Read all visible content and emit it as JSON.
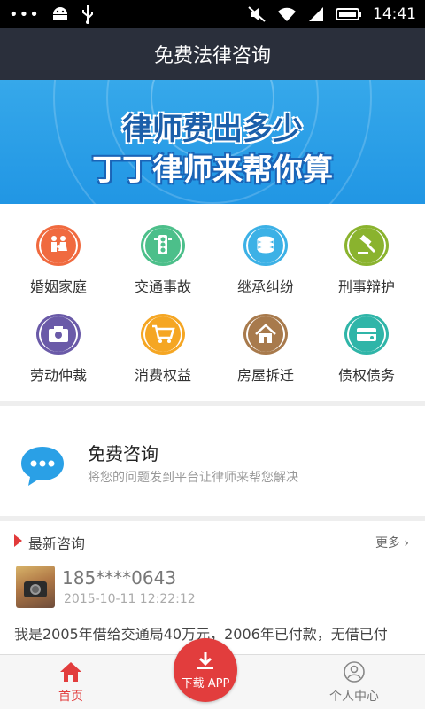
{
  "status_bar": {
    "dots": "•••",
    "time": "14:41",
    "icons": [
      "android-icon",
      "usb-icon",
      "mute-icon",
      "wifi-icon",
      "signal-icon",
      "battery-icon"
    ]
  },
  "header": {
    "title": "免费法律咨询"
  },
  "banner": {
    "line1": "律师费出多少",
    "line2": "丁丁律师来帮你算"
  },
  "categories": [
    {
      "label": "婚姻家庭",
      "icon": "family-icon",
      "color": "#f06a3f"
    },
    {
      "label": "交通事故",
      "icon": "traffic-light-icon",
      "color": "#4cbf8a"
    },
    {
      "label": "继承纠纷",
      "icon": "coins-icon",
      "color": "#3cb1e6"
    },
    {
      "label": "刑事辩护",
      "icon": "gavel-icon",
      "color": "#8ab32e"
    },
    {
      "label": "劳动仲裁",
      "icon": "camera-icon",
      "color": "#6a5aa8"
    },
    {
      "label": "消费权益",
      "icon": "cart-icon",
      "color": "#f5a623"
    },
    {
      "label": "房屋拆迁",
      "icon": "house-icon",
      "color": "#a87a4c"
    },
    {
      "label": "债权债务",
      "icon": "wallet-icon",
      "color": "#2fb5a8"
    }
  ],
  "consult": {
    "title": "免费咨询",
    "subtitle": "将您的问题发到平台让律师来帮您解决"
  },
  "latest": {
    "title": "最新咨询",
    "more": "更多",
    "item": {
      "phone": "185****0643",
      "time": "2015-10-11 12:22:12",
      "message": "我是2005年借给交通局40万元，2006年已付款，无借已付"
    }
  },
  "bottom_nav": {
    "home": "首页",
    "download": "下载 APP",
    "profile": "个人中心"
  },
  "colors": {
    "accent": "#e23d3d",
    "header_bg": "#2a2f3b",
    "banner_bg": "#2196e4"
  }
}
